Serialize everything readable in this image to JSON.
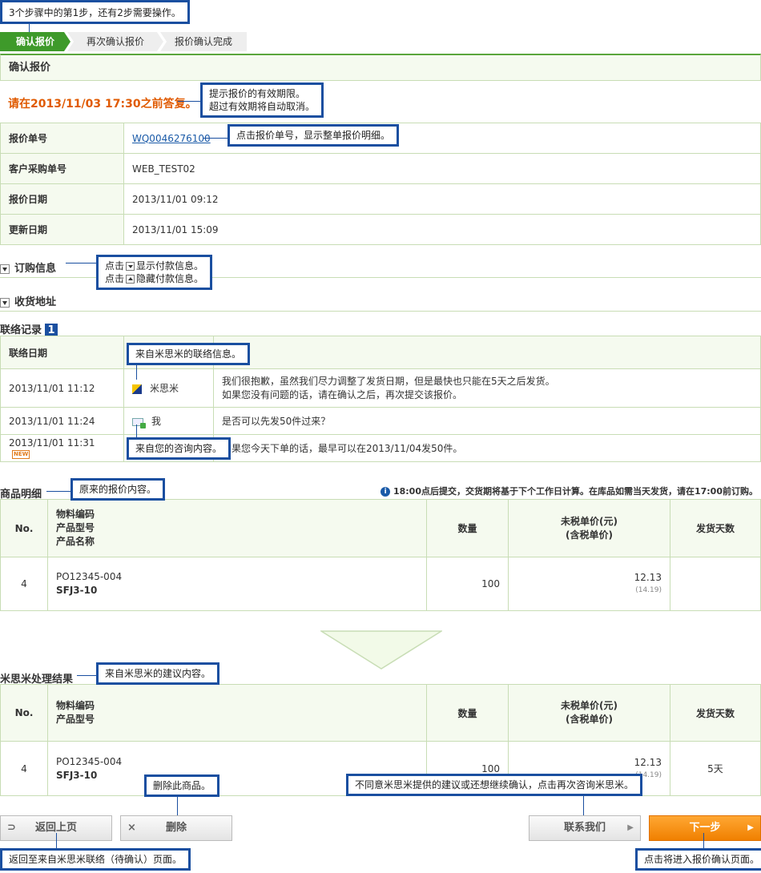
{
  "callouts": {
    "steps": "3个步骤中的第1步，还有2步需要操作。",
    "validity_l1": "提示报价的有效期限。",
    "validity_l2": "超过有效期将自动取消。",
    "quote_no": "点击报价单号，显示整单报价明细。",
    "toggle_show_pre": "点击",
    "toggle_show_post": "显示付款信息。",
    "toggle_hide_pre": "点击",
    "toggle_hide_post": "隐藏付款信息。",
    "misumi_contact": "来自米思米的联络信息。",
    "your_inquiry": "来自您的咨询内容。",
    "original_quote": "原来的报价内容。",
    "misumi_suggest": "来自米思米的建议内容。",
    "delete_item": "删除此商品。",
    "reinquire": "不同意米思米提供的建议或还想继续确认，点击再次咨询米思米。",
    "back_page": "返回至来自米思米联络（待确认）页面。",
    "next_page": "点击将进入报价确认页面。"
  },
  "steps": [
    "确认报价",
    "再次确认报价",
    "报价确认完成"
  ],
  "section_title": "确认报价",
  "deadline": "请在2013/11/03 17:30之前答复。",
  "info_rows": [
    {
      "label": "报价单号",
      "value": "WQ0046276100"
    },
    {
      "label": "客户采购单号",
      "value": "WEB_TEST02"
    },
    {
      "label": "报价日期",
      "value": "2013/11/01 09:12"
    },
    {
      "label": "更新日期",
      "value": "2013/11/01 15:09"
    }
  ],
  "accordions": {
    "order_info": "订购信息",
    "shipping": "收货地址"
  },
  "contact": {
    "title": "联络记录",
    "badge": "1",
    "header_date": "联络日期",
    "rows": [
      {
        "date": "2013/11/01 11:12",
        "from": "米思米",
        "msg1": "我们很抱歉，虽然我们尽力调整了发货日期，但是最快也只能在5天之后发货。",
        "msg2": "如果您没有问题的话，请在确认之后，再次提交该报价。"
      },
      {
        "date": "2013/11/01 11:24",
        "from": "我",
        "msg1": "是否可以先发50件过来？",
        "msg2": ""
      },
      {
        "date": "2013/11/01 11:31",
        "new": "NEW",
        "from": "",
        "msg1": "如果您今天下单的话，最早可以在2013/11/04发50件。",
        "msg2": ""
      }
    ]
  },
  "products": {
    "title": "商品明细",
    "notice": "18:00点后提交，交货期将基于下个工作日计算。在库品如需当天发货，请在17:00前订购。",
    "headers": {
      "no": "No.",
      "code": "物料编码",
      "model": "产品型号",
      "name": "产品名称",
      "qty": "数量",
      "price1": "未税单价(元)",
      "price2": "(含税单价)",
      "days": "发货天数"
    },
    "row": {
      "no": "4",
      "code": "PO12345-004",
      "model": "SFJ3-10",
      "qty": "100",
      "price": "12.13",
      "taxed": "(14.19)",
      "days": ""
    }
  },
  "result": {
    "title": "米思米处理结果",
    "headers": {
      "no": "No.",
      "code": "物料编码",
      "model": "产品型号",
      "qty": "数量",
      "price1": "未税单价(元)",
      "price2": "(含税单价)",
      "days": "发货天数"
    },
    "row": {
      "no": "4",
      "code": "PO12345-004",
      "model": "SFJ3-10",
      "qty": "100",
      "price": "12.13",
      "taxed": "(14.19)",
      "days": "5天"
    }
  },
  "buttons": {
    "back": "返回上页",
    "delete": "删除",
    "contact": "联系我们",
    "next": "下一步"
  }
}
